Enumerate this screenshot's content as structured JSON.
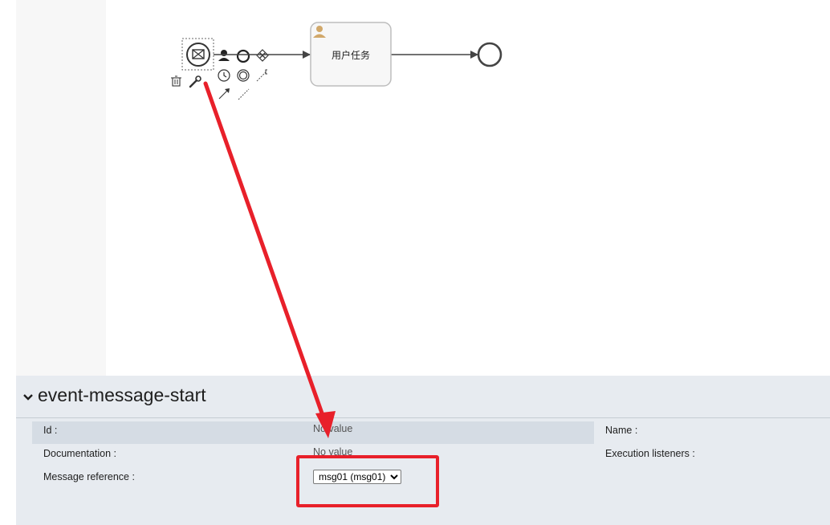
{
  "diagram": {
    "task_label": "用户任务",
    "context_pad_icons": [
      "delete-icon",
      "wrench-icon",
      "user-task-icon",
      "end-event-icon",
      "exclusive-gateway-icon",
      "timer-event-icon",
      "intermediate-event-icon",
      "text-annotation-icon",
      "sequence-flow-icon",
      "association-icon"
    ]
  },
  "properties": {
    "title": "event-message-start",
    "collapse_icon": "chevron-down-icon",
    "id_label": "Id :",
    "id_value": "No value",
    "name_label": "Name :",
    "documentation_label": "Documentation :",
    "documentation_value": "No value",
    "execution_listeners_label": "Execution listeners :",
    "message_reference_label": "Message reference :",
    "message_reference_selected": "msg01 (msg01)"
  },
  "colors": {
    "annotation_red": "#e8202a",
    "panel_bg": "#e7ebf0",
    "user_icon": "#d1a86a"
  }
}
